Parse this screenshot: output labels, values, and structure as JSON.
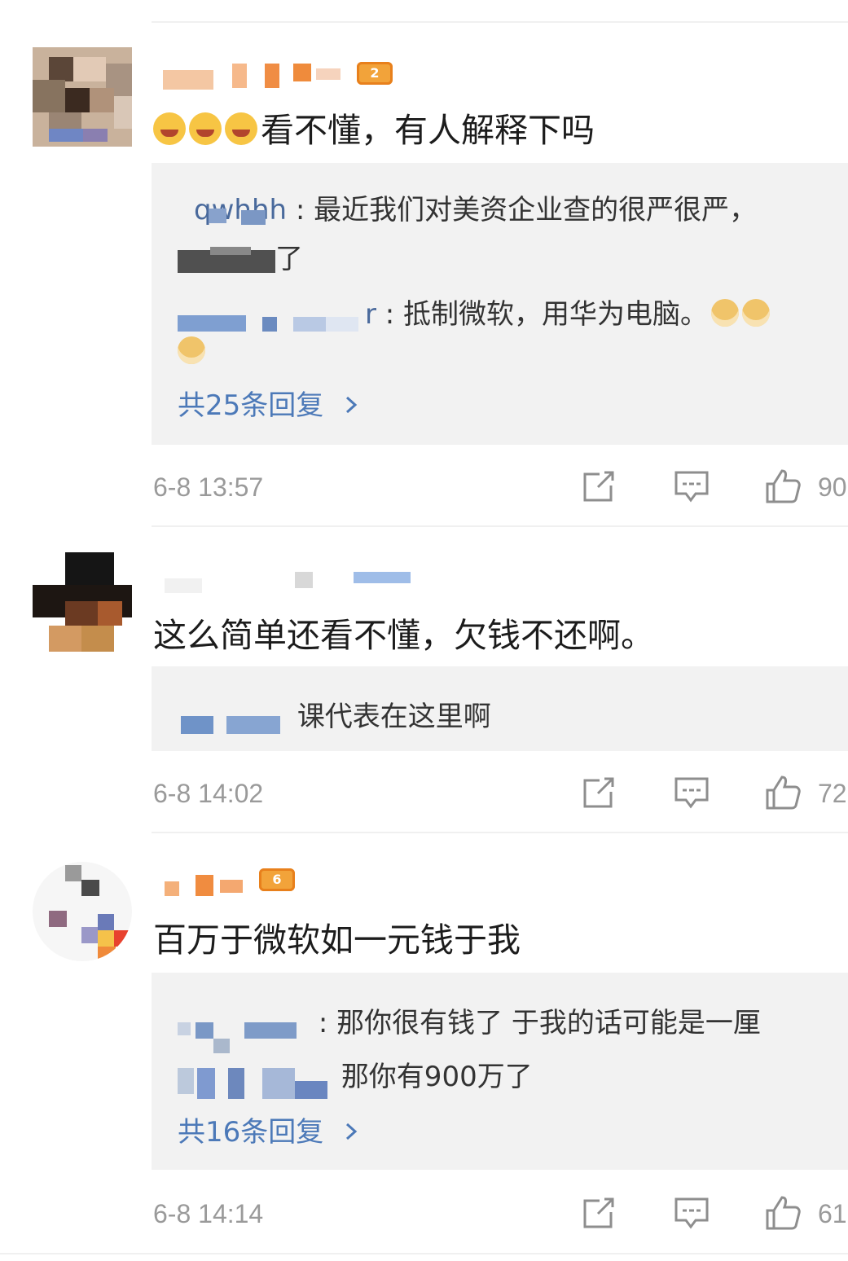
{
  "comments": [
    {
      "text": "看不懂，有人解释下吗",
      "emoji_count": 3,
      "badge": "2",
      "replies": [
        {
          "name_visible": "qwhhh",
          "text": ": 最近我们对美资企业查的很严很严，"
        },
        {
          "name_visible": "",
          "text": "了"
        },
        {
          "name_visible": "r",
          "text": ": 抵制微软，用华为电脑。"
        }
      ],
      "more": "共25条回复",
      "time": "6-8 13:57",
      "likes": "90"
    },
    {
      "text": "这么简单还看不懂，欠钱不还啊。",
      "replies": [
        {
          "name_visible": "",
          "text": "课代表在这里啊"
        }
      ],
      "time": "6-8 14:02",
      "likes": "72"
    },
    {
      "text": "百万于微软如一元钱于我",
      "badge": "6",
      "replies": [
        {
          "name_visible": "",
          "text": ": 那你很有钱了 于我的话可能是一厘"
        },
        {
          "name_visible": "",
          "text": "那你有900万了"
        }
      ],
      "more": "共16条回复",
      "time": "6-8 14:14",
      "likes": "61"
    }
  ],
  "icons": {
    "share": "share-icon",
    "comment": "comment-icon",
    "like": "thumbs-up-icon",
    "chevron": "chevron-right-icon",
    "emoji": "laughing-crying-emoji-icon",
    "doge": "doge-emoji-icon"
  },
  "colors": {
    "link": "#4c79b8",
    "reply_bg": "#f2f2f2",
    "meta": "#9a9a9a",
    "badge": "#f2a33a"
  }
}
